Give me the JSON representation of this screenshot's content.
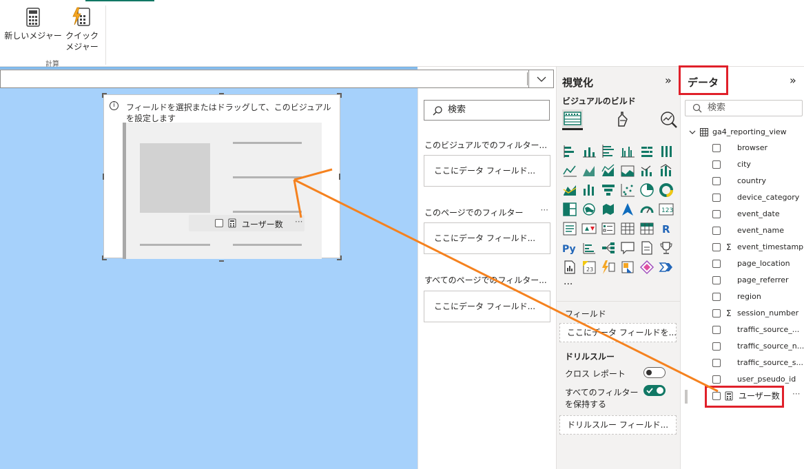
{
  "ribbon": {
    "new_measure": "新しいメジャー",
    "quick_measure_line1": "クイック",
    "quick_measure_line2": "メジャー",
    "group_label": "計算"
  },
  "visual": {
    "message": "フィールドを選択またはドラッグして、このビジュアルを設定します",
    "chip_label": "ユーザー数",
    "chip_more": "···"
  },
  "filters": {
    "search_placeholder": "検索",
    "sections": [
      {
        "title": "このビジュアルでのフィルター...",
        "drop": "ここにデータ フィールド..."
      },
      {
        "title": "このページでのフィルター",
        "drop": "ここにデータ フィールド..."
      },
      {
        "title": "すべてのページでのフィルター...",
        "drop": "ここにデータ フィールド..."
      }
    ],
    "more": "···"
  },
  "visualizations": {
    "title": "視覚化",
    "collapse": "»",
    "build_label": "ビジュアルのビルド",
    "more": "···",
    "fields_label": "フィールド",
    "fields_drop": "ここにデータ フィールドを...",
    "drillthrough_label": "ドリルスルー",
    "cross_report_label": "クロス レポート",
    "keep_filters_label_1": "すべてのフィルター",
    "keep_filters_label_2": "を保持する",
    "cross_report_on": false,
    "keep_filters_on": true,
    "drillthrough_drop": "ドリルスルー フィールド..."
  },
  "data": {
    "title": "データ",
    "collapse": "»",
    "search_placeholder": "検索",
    "table_name": "ga4_reporting_view",
    "fields": [
      {
        "name": "browser",
        "sum": false
      },
      {
        "name": "city",
        "sum": false
      },
      {
        "name": "country",
        "sum": false
      },
      {
        "name": "device_category",
        "sum": false
      },
      {
        "name": "event_date",
        "sum": false
      },
      {
        "name": "event_name",
        "sum": false
      },
      {
        "name": "event_timestamp",
        "sum": true
      },
      {
        "name": "page_location",
        "sum": false
      },
      {
        "name": "page_referrer",
        "sum": false
      },
      {
        "name": "region",
        "sum": false
      },
      {
        "name": "session_number",
        "sum": true
      },
      {
        "name": "traffic_source_...",
        "sum": false
      },
      {
        "name": "traffic_source_n...",
        "sum": false
      },
      {
        "name": "traffic_source_s...",
        "sum": false
      },
      {
        "name": "user_pseudo_id",
        "sum": false
      }
    ],
    "measure": "ユーザー数",
    "measure_more": "···"
  },
  "colors": {
    "canvas": "#a6d1fb",
    "highlight": "#e0202a",
    "arrow": "#f5821f",
    "toggle_on": "#117865"
  }
}
